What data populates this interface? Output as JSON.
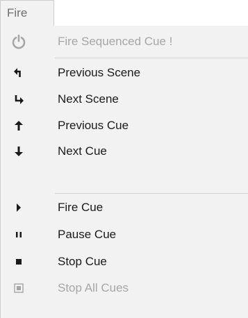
{
  "menubar": {
    "open_menu": "Fire"
  },
  "menu": {
    "items": [
      {
        "label": "Fire Sequenced Cue !",
        "icon": "power-icon",
        "enabled": false
      },
      {
        "label": "Previous Scene",
        "icon": "return-up-left-icon",
        "enabled": true
      },
      {
        "label": "Next Scene",
        "icon": "return-down-right-icon",
        "enabled": true
      },
      {
        "label": "Previous Cue",
        "icon": "arrow-up-icon",
        "enabled": true
      },
      {
        "label": "Next Cue",
        "icon": "arrow-down-icon",
        "enabled": true
      },
      {
        "label": "Fire Cue",
        "icon": "play-icon",
        "enabled": true
      },
      {
        "label": "Pause Cue",
        "icon": "pause-icon",
        "enabled": true
      },
      {
        "label": "Stop Cue",
        "icon": "stop-icon",
        "enabled": true
      },
      {
        "label": "Stop All Cues",
        "icon": "stop-all-icon",
        "enabled": false
      }
    ]
  },
  "colors": {
    "menu_background": "#f2f2f2",
    "text": "#1a1a1a",
    "disabled_text": "#a6a6a6",
    "menu_title_text": "#6d6d6d"
  }
}
